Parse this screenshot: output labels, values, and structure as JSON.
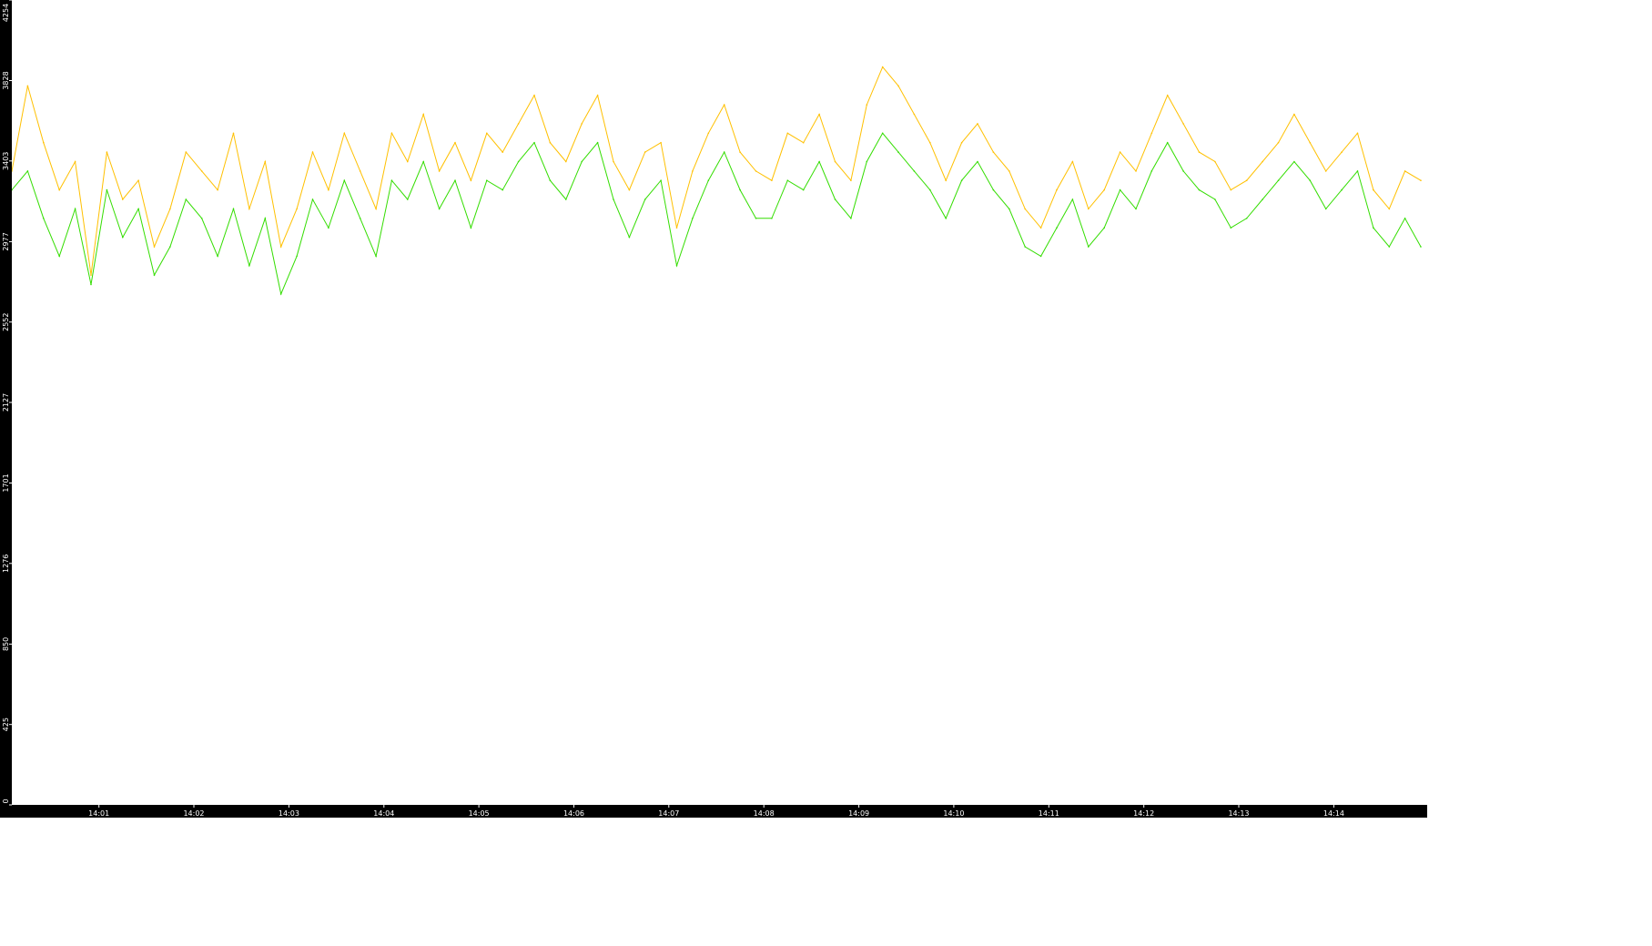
{
  "chart_data": {
    "type": "line",
    "title": "",
    "xlabel": "",
    "ylabel": "",
    "ylim": [
      0,
      4254
    ],
    "y_ticks": [
      "0",
      "425",
      "850",
      "1276",
      "1701",
      "2127",
      "2552",
      "2977",
      "3403",
      "3828",
      "4254"
    ],
    "x_ticks": [
      "14:01",
      "14:02",
      "14:03",
      "14:04",
      "14:05",
      "14:06",
      "14:07",
      "14:08",
      "14:09",
      "14:10",
      "14:11",
      "14:12",
      "14:13",
      "14:14"
    ],
    "xlim": [
      "14:00:05",
      "14:14:59"
    ],
    "grid": false,
    "legend": "none",
    "colors": {
      "background": "#ffffff",
      "axis_band": "#000000",
      "axis_text": "#ffffff"
    },
    "series": [
      {
        "color": "#ffc000",
        "x": [
          "14:00:05",
          "14:00:15",
          "14:00:25",
          "14:00:35",
          "14:00:45",
          "14:00:55",
          "14:01:05",
          "14:01:15",
          "14:01:25",
          "14:01:35",
          "14:01:45",
          "14:01:55",
          "14:02:05",
          "14:02:15",
          "14:02:25",
          "14:02:35",
          "14:02:45",
          "14:02:55",
          "14:03:05",
          "14:03:15",
          "14:03:25",
          "14:03:35",
          "14:03:45",
          "14:03:55",
          "14:04:05",
          "14:04:15",
          "14:04:25",
          "14:04:35",
          "14:04:45",
          "14:04:55",
          "14:05:05",
          "14:05:15",
          "14:05:25",
          "14:05:35",
          "14:05:45",
          "14:05:55",
          "14:06:05",
          "14:06:15",
          "14:06:25",
          "14:06:35",
          "14:06:45",
          "14:06:55",
          "14:07:05",
          "14:07:15",
          "14:07:25",
          "14:07:35",
          "14:07:45",
          "14:07:55",
          "14:08:05",
          "14:08:15",
          "14:08:25",
          "14:08:35",
          "14:08:45",
          "14:08:55",
          "14:09:05",
          "14:09:15",
          "14:09:25",
          "14:09:35",
          "14:09:45",
          "14:09:55",
          "14:10:05",
          "14:10:15",
          "14:10:25",
          "14:10:35",
          "14:10:45",
          "14:10:55",
          "14:11:05",
          "14:11:15",
          "14:11:25",
          "14:11:35",
          "14:11:45",
          "14:11:55",
          "14:12:05",
          "14:12:15",
          "14:12:25",
          "14:12:35",
          "14:12:45",
          "14:12:55",
          "14:13:05",
          "14:13:15",
          "14:13:25",
          "14:13:35",
          "14:13:45",
          "14:13:55",
          "14:14:05",
          "14:14:15",
          "14:14:25",
          "14:14:35",
          "14:14:45",
          "14:14:55"
        ],
        "values": [
          3350,
          3800,
          3500,
          3250,
          3400,
          2800,
          3450,
          3200,
          3300,
          2950,
          3150,
          3450,
          3350,
          3250,
          3550,
          3150,
          3400,
          2950,
          3150,
          3450,
          3250,
          3550,
          3350,
          3150,
          3550,
          3400,
          3650,
          3350,
          3500,
          3300,
          3550,
          3450,
          3600,
          3750,
          3500,
          3400,
          3600,
          3750,
          3400,
          3250,
          3450,
          3500,
          3050,
          3350,
          3550,
          3700,
          3450,
          3350,
          3300,
          3550,
          3500,
          3650,
          3400,
          3300,
          3700,
          3900,
          3800,
          3650,
          3500,
          3300,
          3500,
          3600,
          3450,
          3350,
          3150,
          3050,
          3250,
          3400,
          3150,
          3250,
          3450,
          3350,
          3550,
          3750,
          3600,
          3450,
          3400,
          3250,
          3300,
          3400,
          3500,
          3650,
          3500,
          3350,
          3450,
          3550,
          3250,
          3150,
          3350,
          3300
        ]
      },
      {
        "color": "#33dd00",
        "x": [
          "14:00:05",
          "14:00:15",
          "14:00:25",
          "14:00:35",
          "14:00:45",
          "14:00:55",
          "14:01:05",
          "14:01:15",
          "14:01:25",
          "14:01:35",
          "14:01:45",
          "14:01:55",
          "14:02:05",
          "14:02:15",
          "14:02:25",
          "14:02:35",
          "14:02:45",
          "14:02:55",
          "14:03:05",
          "14:03:15",
          "14:03:25",
          "14:03:35",
          "14:03:45",
          "14:03:55",
          "14:04:05",
          "14:04:15",
          "14:04:25",
          "14:04:35",
          "14:04:45",
          "14:04:55",
          "14:05:05",
          "14:05:15",
          "14:05:25",
          "14:05:35",
          "14:05:45",
          "14:05:55",
          "14:06:05",
          "14:06:15",
          "14:06:25",
          "14:06:35",
          "14:06:45",
          "14:06:55",
          "14:07:05",
          "14:07:15",
          "14:07:25",
          "14:07:35",
          "14:07:45",
          "14:07:55",
          "14:08:05",
          "14:08:15",
          "14:08:25",
          "14:08:35",
          "14:08:45",
          "14:08:55",
          "14:09:05",
          "14:09:15",
          "14:09:25",
          "14:09:35",
          "14:09:45",
          "14:09:55",
          "14:10:05",
          "14:10:15",
          "14:10:25",
          "14:10:35",
          "14:10:45",
          "14:10:55",
          "14:11:05",
          "14:11:15",
          "14:11:25",
          "14:11:35",
          "14:11:45",
          "14:11:55",
          "14:12:05",
          "14:12:15",
          "14:12:25",
          "14:12:35",
          "14:12:45",
          "14:12:55",
          "14:13:05",
          "14:13:15",
          "14:13:25",
          "14:13:35",
          "14:13:45",
          "14:13:55",
          "14:14:05",
          "14:14:15",
          "14:14:25",
          "14:14:35",
          "14:14:45",
          "14:14:55"
        ],
        "values": [
          3250,
          3350,
          3100,
          2900,
          3150,
          2750,
          3250,
          3000,
          3150,
          2800,
          2950,
          3200,
          3100,
          2900,
          3150,
          2850,
          3100,
          2700,
          2900,
          3200,
          3050,
          3300,
          3100,
          2900,
          3300,
          3200,
          3400,
          3150,
          3300,
          3050,
          3300,
          3250,
          3400,
          3500,
          3300,
          3200,
          3400,
          3500,
          3200,
          3000,
          3200,
          3300,
          2850,
          3100,
          3300,
          3450,
          3250,
          3100,
          3100,
          3300,
          3250,
          3400,
          3200,
          3100,
          3400,
          3550,
          3450,
          3350,
          3250,
          3100,
          3300,
          3400,
          3250,
          3150,
          2950,
          2900,
          3050,
          3200,
          2950,
          3050,
          3250,
          3150,
          3350,
          3500,
          3350,
          3250,
          3200,
          3050,
          3100,
          3200,
          3300,
          3400,
          3300,
          3150,
          3250,
          3350,
          3050,
          2950,
          3100,
          2950
        ]
      }
    ]
  }
}
